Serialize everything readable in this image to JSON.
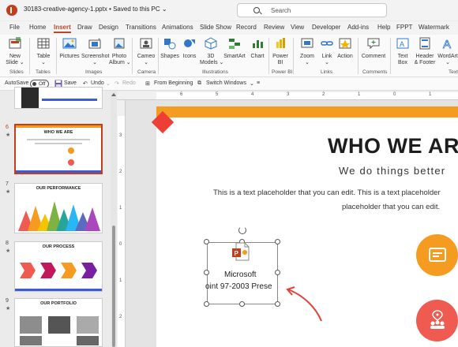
{
  "titlebar": {
    "doc_title": "30183-creative-agency-1.pptx • Saved to this PC ⌄",
    "search_placeholder": "Search"
  },
  "ribbon_tabs": [
    "File",
    "Home",
    "Insert",
    "Draw",
    "Design",
    "Transitions",
    "Animations",
    "Slide Show",
    "Record",
    "Review",
    "View",
    "Developer",
    "Add-ins",
    "Help",
    "FPPT",
    "Watermark"
  ],
  "active_tab": "Insert",
  "ribbon": {
    "buttons": [
      {
        "label": "New\nSlide ⌄",
        "icon": "new-slide-icon"
      },
      {
        "label": "Table\n⌄",
        "icon": "table-icon"
      },
      {
        "label": "Pictures",
        "icon": "pictures-icon"
      },
      {
        "label": "Screenshot\n⌄",
        "icon": "screenshot-icon"
      },
      {
        "label": "Photo\nAlbum ⌄",
        "icon": "photo-album-icon"
      },
      {
        "label": "Cameo\n⌄",
        "icon": "cameo-icon"
      },
      {
        "label": "Shapes",
        "icon": "shapes-icon"
      },
      {
        "label": "Icons",
        "icon": "icons-icon"
      },
      {
        "label": "3D\nModels ⌄",
        "icon": "3d-models-icon"
      },
      {
        "label": "SmartArt",
        "icon": "smartart-icon"
      },
      {
        "label": "Chart",
        "icon": "chart-icon"
      },
      {
        "label": "Power\nBI",
        "icon": "power-bi-icon"
      },
      {
        "label": "Zoom\n⌄",
        "icon": "zoom-icon"
      },
      {
        "label": "Link\n⌄",
        "icon": "link-icon"
      },
      {
        "label": "Action",
        "icon": "action-icon"
      },
      {
        "label": "Comment",
        "icon": "comment-icon"
      },
      {
        "label": "Text\nBox",
        "icon": "text-box-icon"
      },
      {
        "label": "Header\n& Footer",
        "icon": "header-footer-icon"
      },
      {
        "label": "WordArt\n⌄",
        "icon": "wordart-icon"
      }
    ],
    "groups": [
      "Slides",
      "Tables",
      "Images",
      "Camera",
      "Illustrations",
      "Power BI",
      "Links",
      "Comments",
      "Text"
    ]
  },
  "qat": {
    "autosave_label": "AutoSave",
    "autosave_state": "Off",
    "save": "Save",
    "undo": "Undo",
    "redo": "Redo",
    "from_beginning": "From Beginning",
    "switch_windows": "Switch Windows"
  },
  "thumbnails": [
    {
      "number": "6",
      "star": "★",
      "title": "WHO WE ARE",
      "selected": true
    },
    {
      "number": "7",
      "star": "★",
      "title": "OUR PERFORMANCE",
      "selected": false
    },
    {
      "number": "8",
      "star": "★",
      "title": "OUR PROCESS",
      "selected": false
    },
    {
      "number": "9",
      "star": "★",
      "title": "OUR PORTFOLIO",
      "selected": false
    }
  ],
  "ruler_top": [
    "6",
    "5",
    "4",
    "3",
    "2",
    "1",
    "0",
    "1"
  ],
  "ruler_left": [
    "3",
    "2",
    "1",
    "0",
    "1",
    "2"
  ],
  "slide": {
    "title": "WHO WE AR",
    "subtitle": "We do things better",
    "body_line1": "This is a text placeholder that you can edit. This is a text placeholder",
    "body_line2": "placeholder that you can edit.",
    "object_label_line1": "Microsoft",
    "object_label_line2": "oint 97-2003 Prese"
  },
  "colors": {
    "accent": "#c43e1c",
    "orange": "#f59b20",
    "red": "#ef5b50",
    "arrow": "#e0433a"
  }
}
